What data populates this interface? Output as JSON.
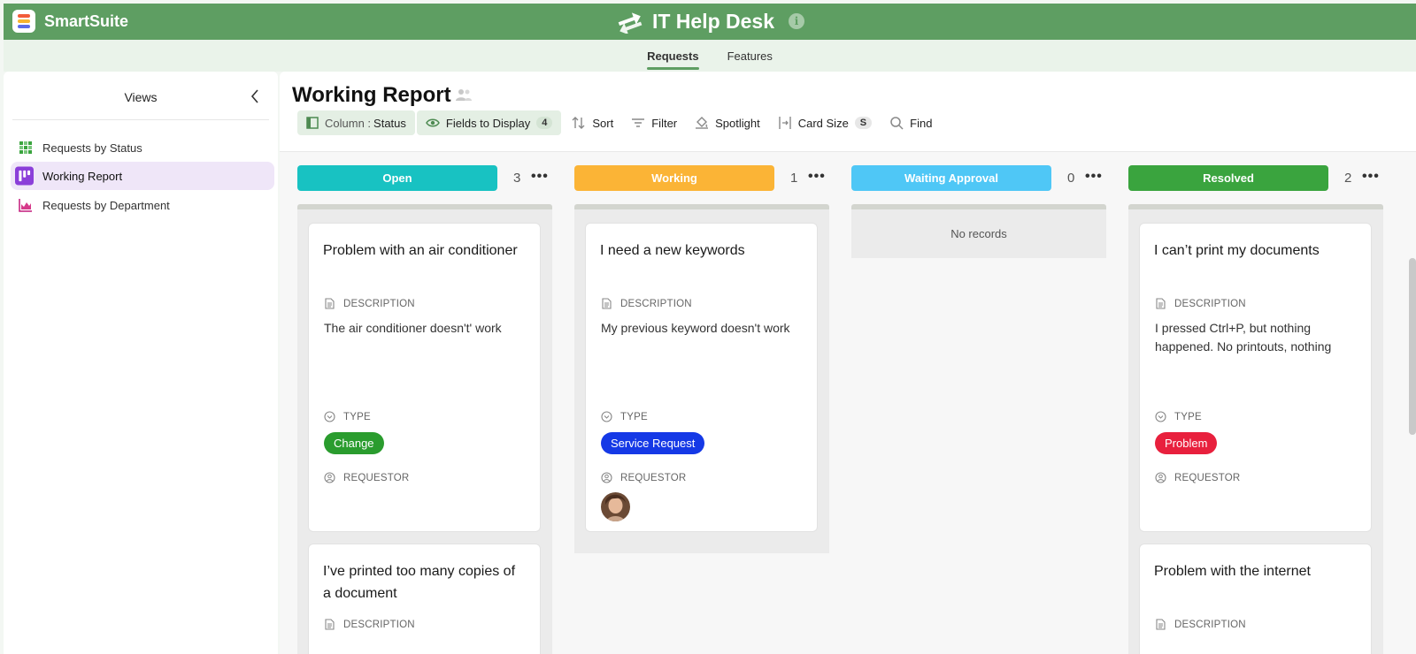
{
  "brand": {
    "name": "SmartSuite"
  },
  "app": {
    "title": "IT Help Desk"
  },
  "tabs": [
    {
      "label": "Requests",
      "active": true
    },
    {
      "label": "Features",
      "active": false
    }
  ],
  "sidebar": {
    "title": "Views",
    "items": [
      {
        "label": "Requests by Status",
        "icon": "grid-icon",
        "active": false
      },
      {
        "label": "Working Report",
        "icon": "kanban-icon",
        "active": true
      },
      {
        "label": "Requests by Department",
        "icon": "chart-icon",
        "active": false
      }
    ]
  },
  "report": {
    "title": "Working Report"
  },
  "toolbar": {
    "column_label": "Column :",
    "column_value": "Status",
    "fields_label": "Fields to Display",
    "fields_count": "4",
    "sort_label": "Sort",
    "filter_label": "Filter",
    "spotlight_label": "Spotlight",
    "card_size_label": "Card Size",
    "card_size_value": "S",
    "find_label": "Find"
  },
  "labels": {
    "description": "DESCRIPTION",
    "type": "TYPE",
    "requestor": "REQUESTOR",
    "no_records": "No records",
    "more": "•••"
  },
  "columns": [
    {
      "label": "Open",
      "count": "3",
      "color": "#18c2c2",
      "cards": [
        {
          "title": "Problem with an air conditioner",
          "description": "The air conditioner doesn't' work",
          "type": "Change",
          "type_color": "#2a9c2e"
        },
        {
          "title": "I’ve printed too many copies of a document"
        }
      ]
    },
    {
      "label": "Working",
      "count": "1",
      "color": "#fbb436",
      "cards": [
        {
          "title": "I need a new keywords",
          "description": "My previous keyword doesn't work",
          "type": "Service Request",
          "type_color": "#1539e6"
        }
      ]
    },
    {
      "label": "Waiting Approval",
      "count": "0",
      "color": "#4fc7f6",
      "cards": []
    },
    {
      "label": "Resolved",
      "count": "2",
      "color": "#3aa43e",
      "cards": [
        {
          "title": "I can’t print my documents",
          "description": "I pressed Ctrl+P, but nothing happened. No printouts, nothing",
          "type": "Problem",
          "type_color": "#e8203d"
        },
        {
          "title": "Problem with the internet"
        }
      ]
    }
  ]
}
